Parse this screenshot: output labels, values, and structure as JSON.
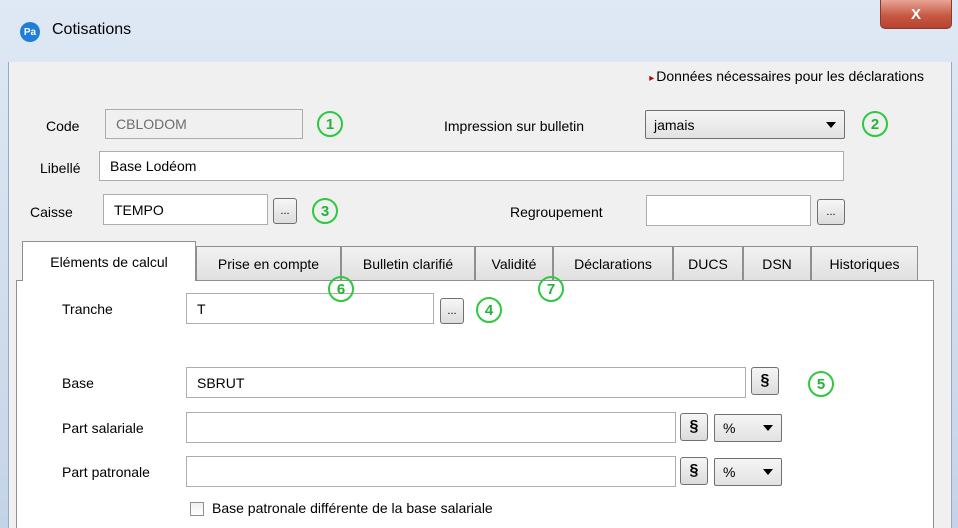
{
  "window": {
    "app_icon": "Pa",
    "title": "Cotisations",
    "close_label": "X"
  },
  "note": {
    "marker": "▸",
    "text": "Données nécessaires pour les déclarations"
  },
  "form": {
    "code_label": "Code",
    "code_value": "CBLODOM",
    "impression_label": "Impression sur bulletin",
    "impression_value": "jamais",
    "libelle_label": "Libellé",
    "libelle_value": "Base Lodéom",
    "caisse_label": "Caisse",
    "caisse_value": "TEMPO",
    "caisse_button": "...",
    "regroupement_label": "Regroupement",
    "regroupement_value": "",
    "regroupement_button": "..."
  },
  "tabs": [
    {
      "label": "Eléments de calcul",
      "active": true
    },
    {
      "label": "Prise en compte"
    },
    {
      "label": "Bulletin clarifié"
    },
    {
      "label": "Validité"
    },
    {
      "label": "Déclarations"
    },
    {
      "label": "DUCS"
    },
    {
      "label": "DSN"
    },
    {
      "label": "Historiques"
    }
  ],
  "panel": {
    "tranche_label": "Tranche",
    "tranche_value": "T",
    "tranche_button": "...",
    "base_label": "Base",
    "base_value": "SBRUT",
    "part_salariale_label": "Part salariale",
    "part_salariale_value": "",
    "part_salariale_unit": "%",
    "part_patronale_label": "Part patronale",
    "part_patronale_value": "",
    "part_patronale_unit": "%",
    "para_symbol": "§",
    "checkbox_label": "Base patronale différente de la base salariale",
    "checkbox_checked": false
  },
  "annotations": [
    "1",
    "2",
    "3",
    "4",
    "5",
    "6",
    "7"
  ],
  "colors": {
    "annotation": "#2ec940",
    "note_marker": "#c00000",
    "close_button": "#c75a45",
    "app_icon": "#1f7fd8"
  }
}
